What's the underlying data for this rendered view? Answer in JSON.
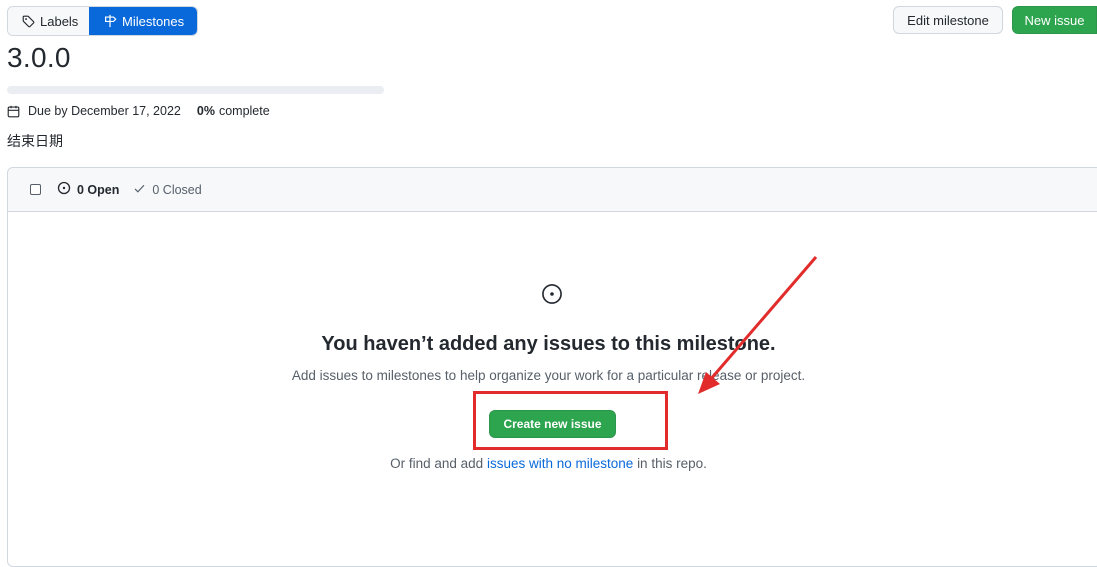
{
  "tabs": {
    "labels": "Labels",
    "milestones": "Milestones"
  },
  "actions": {
    "edit_milestone": "Edit milestone",
    "new_issue": "New issue"
  },
  "milestone": {
    "title": "3.0.0",
    "due": "Due by December 17, 2022",
    "percent": "0%",
    "percent_label": "complete",
    "progress_fraction": 0,
    "description": "结束日期"
  },
  "issues_header": {
    "open_label": "0 Open",
    "closed_label": "0 Closed"
  },
  "blankslate": {
    "title": "You haven’t added any issues to this milestone.",
    "subtitle": "Add issues to milestones to help organize your work for a particular release or project.",
    "create_button": "Create new issue",
    "find_prefix": "Or find and add",
    "find_link": "issues with no milestone",
    "find_suffix": "in this repo."
  },
  "colors": {
    "primary_blue": "#0969da",
    "success_green": "#2da44e",
    "annotation_red": "#e22b2b"
  },
  "icons": [
    "tag-icon",
    "milestone-icon",
    "calendar-icon",
    "issue-opened-icon",
    "check-icon"
  ]
}
